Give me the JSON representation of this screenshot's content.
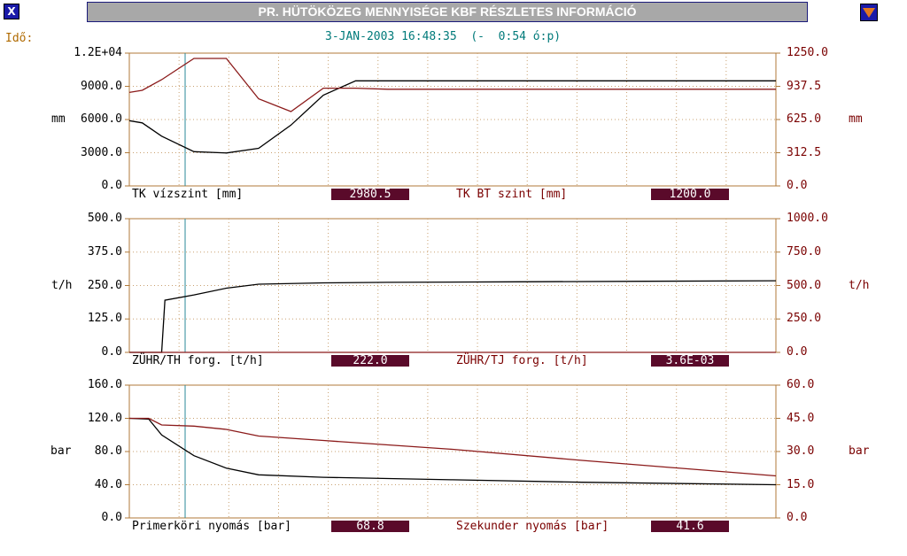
{
  "window": {
    "title": "PR. HÜTÖKÖZEG MENNYISÉGE KBF RÉSZLETES INFORMÁCIÓ",
    "close_label": "X",
    "time_label": "Idő:",
    "timestamp": "3-JAN-2003 16:48:35  (-  0:54 ó:p)"
  },
  "colors": {
    "left_series": "#000000",
    "right_series": "#8b1a1a",
    "frame": "#b07a3a",
    "cursor": "#2a8a9a",
    "value_box": "#5a0a2a"
  },
  "panels": [
    {
      "left_ticks": [
        "1.2E+04",
        "9000.0",
        "6000.0",
        "3000.0",
        "0.0"
      ],
      "right_ticks": [
        "1250.0",
        "937.5",
        "625.0",
        "312.5",
        "0.0"
      ],
      "left_unit": "mm",
      "right_unit": "mm",
      "left_label": "TK vízszint [mm]",
      "left_value": "2980.5",
      "right_label": "TK BT szint [mm]",
      "right_value": "1200.0"
    },
    {
      "left_ticks": [
        "500.0",
        "375.0",
        "250.0",
        "125.0",
        "0.0"
      ],
      "right_ticks": [
        "1000.0",
        "750.0",
        "500.0",
        "250.0",
        "0.0"
      ],
      "left_unit": "t/h",
      "right_unit": "t/h",
      "left_label": "ZÜHR/TH forg. [t/h]",
      "left_value": "222.0",
      "right_label": "ZÜHR/TJ forg. [t/h]",
      "right_value": "3.6E-03"
    },
    {
      "left_ticks": [
        "160.0",
        "120.0",
        "80.0",
        "40.0",
        "0.0"
      ],
      "right_ticks": [
        "60.0",
        "45.0",
        "30.0",
        "15.0",
        "0.0"
      ],
      "left_unit": "bar",
      "right_unit": "bar",
      "left_label": "Primerköri nyomás [bar]",
      "left_value": "68.8",
      "right_label": "Szekunder nyomás [bar]",
      "right_value": "41.6"
    }
  ],
  "chart_data": [
    {
      "type": "line",
      "x": [
        0,
        2,
        5,
        10,
        15,
        20,
        25,
        30,
        35,
        40,
        50,
        60,
        80,
        100
      ],
      "series": [
        {
          "name": "TK vízszint [mm]",
          "axis": "left",
          "values": [
            5900,
            5700,
            4500,
            3100,
            2980,
            3400,
            5500,
            8200,
            9500,
            9500,
            9500,
            9500,
            9500,
            9500
          ]
        },
        {
          "name": "TK BT szint [mm]",
          "axis": "right",
          "values": [
            880,
            900,
            1000,
            1200,
            1200,
            820,
            700,
            920,
            920,
            910,
            910,
            910,
            910,
            910
          ]
        }
      ],
      "ylim_left": [
        0,
        12000
      ],
      "ylim_right": [
        0,
        1250
      ]
    },
    {
      "type": "line",
      "x": [
        0,
        5,
        5.5,
        10,
        15,
        20,
        30,
        40,
        60,
        80,
        100
      ],
      "series": [
        {
          "name": "ZÜHR/TH forg. [t/h]",
          "axis": "left",
          "values": [
            0,
            0,
            195,
            215,
            240,
            255,
            260,
            262,
            264,
            266,
            268
          ]
        },
        {
          "name": "ZÜHR/TJ forg. [t/h]",
          "axis": "right",
          "values": [
            0,
            0,
            0,
            0,
            0,
            0,
            0,
            0,
            0,
            0,
            0
          ]
        }
      ],
      "ylim_left": [
        0,
        500
      ],
      "ylim_right": [
        0,
        1000
      ]
    },
    {
      "type": "line",
      "x": [
        0,
        3,
        5,
        10,
        15,
        20,
        30,
        50,
        70,
        100
      ],
      "series": [
        {
          "name": "Primerköri nyomás [bar]",
          "axis": "left",
          "values": [
            120,
            119,
            100,
            75,
            60,
            52,
            49,
            46,
            43,
            40
          ]
        },
        {
          "name": "Szekunder nyomás [bar]",
          "axis": "right",
          "values": [
            45,
            45,
            42,
            41.5,
            40,
            37,
            35,
            31,
            26,
            19
          ]
        }
      ],
      "ylim_left": [
        0,
        160
      ],
      "ylim_right": [
        0,
        60
      ]
    }
  ]
}
